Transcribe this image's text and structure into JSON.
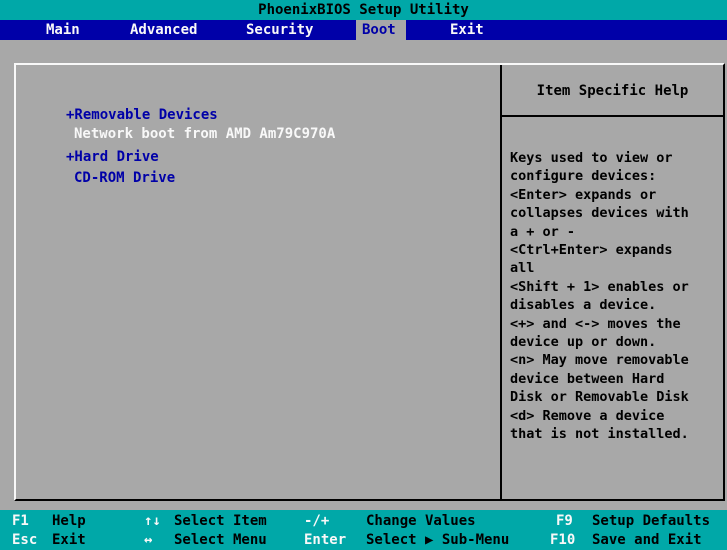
{
  "title": "PhoenixBIOS Setup Utility",
  "menu": [
    "Main",
    "Advanced",
    "Security",
    "Boot",
    "Exit"
  ],
  "active_menu": "Boot",
  "boot_items": [
    "+Removable Devices",
    "Network boot from AMD Am79C970A",
    "+Hard Drive",
    "CD-ROM Drive"
  ],
  "help": {
    "title": "Item Specific Help",
    "lines": [
      "Keys used to view or",
      "configure devices:",
      "<Enter> expands or",
      "collapses devices with",
      "a + or -",
      "<Ctrl+Enter> expands",
      "all",
      "<Shift + 1> enables or",
      "disables a device.",
      "<+> and <-> moves the",
      "device up or down.",
      "<n> May move removable",
      "device between Hard",
      "Disk or Removable Disk",
      "<d> Remove a device",
      "that is not installed."
    ]
  },
  "footer": {
    "row1": {
      "k1": "F1",
      "d1": "Help",
      "k2": "↑↓",
      "d2": "Select Item",
      "k3": "-/+",
      "d3": "Change Values",
      "k4": "F9",
      "d4": "Setup Defaults"
    },
    "row2": {
      "k1": "Esc",
      "d1": "Exit",
      "k2": "↔",
      "d2": "Select Menu",
      "k3": "Enter",
      "d3": "Select ▶ Sub-Menu",
      "k4": "F10",
      "d4": "Save and Exit"
    }
  },
  "colors": {
    "title_bg": "#00a8a8",
    "menu_bg": "#0000a8",
    "panel_bg": "#a8a8a8",
    "highlight_text": "#f8f8f8"
  }
}
